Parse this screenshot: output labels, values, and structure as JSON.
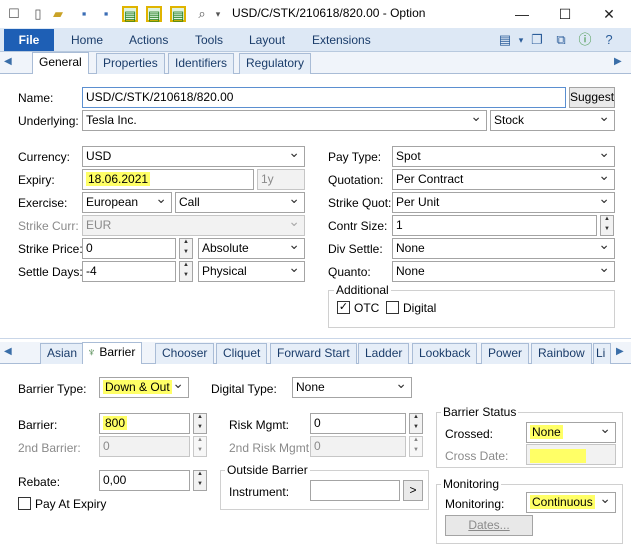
{
  "window": {
    "title": "USD/C/STK/210618/820.00 - Option",
    "minimize": "—",
    "maximize": "☐",
    "close": "✕"
  },
  "ribbon": {
    "file": "File",
    "tabs": [
      "Home",
      "Actions",
      "Tools",
      "Layout",
      "Extensions"
    ]
  },
  "top_tabs": [
    "General",
    "Properties",
    "Identifiers",
    "Regulatory"
  ],
  "general": {
    "name_label": "Name:",
    "name_value": "USD/C/STK/210618/820.00",
    "suggest": "Suggest",
    "underlying_label": "Underlying:",
    "underlying_value": "Tesla Inc.",
    "underlying_type": "Stock",
    "currency_label": "Currency:",
    "currency_value": "USD",
    "expiry_label": "Expiry:",
    "expiry_value": "18.06.2021",
    "expiry_tenor": "1y",
    "exercise_label": "Exercise:",
    "exercise_style": "European",
    "exercise_type": "Call",
    "strike_curr_label": "Strike Curr:",
    "strike_curr_value": "EUR",
    "strike_price_label": "Strike Price:",
    "strike_price_value": "0",
    "strike_price_mode": "Absolute",
    "settle_days_label": "Settle Days:",
    "settle_days_value": "-4",
    "settle_type": "Physical",
    "pay_type_label": "Pay Type:",
    "pay_type_value": "Spot",
    "quotation_label": "Quotation:",
    "quotation_value": "Per Contract",
    "strike_quot_label": "Strike Quot:",
    "strike_quot_value": "Per Unit",
    "contr_size_label": "Contr Size:",
    "contr_size_value": "1",
    "div_settle_label": "Div Settle:",
    "div_settle_value": "None",
    "quanto_label": "Quanto:",
    "quanto_value": "None",
    "additional_title": "Additional",
    "otc_label": "OTC",
    "otc_checked": "✓",
    "digital_label": "Digital"
  },
  "bottom_tabs": [
    "Asian",
    "Barrier",
    "Chooser",
    "Cliquet",
    "Forward Start",
    "Ladder",
    "Lookback",
    "Power",
    "Rainbow",
    "Li"
  ],
  "barrier": {
    "barrier_type_label": "Barrier Type:",
    "barrier_type_value": "Down & Out",
    "digital_type_label": "Digital Type:",
    "digital_type_value": "None",
    "barrier_label": "Barrier:",
    "barrier_value": "800",
    "second_barrier_label": "2nd Barrier:",
    "second_barrier_value": "0",
    "risk_mgmt_label": "Risk Mgmt:",
    "risk_mgmt_value": "0",
    "second_risk_mgmt_label": "2nd Risk Mgmt:",
    "second_risk_mgmt_value": "0",
    "rebate_label": "Rebate:",
    "rebate_value": "0,00",
    "pay_at_expiry_label": "Pay At Expiry",
    "outside_barrier_title": "Outside Barrier",
    "instrument_label": "Instrument:",
    "instrument_value": "",
    "browse": ">",
    "status_title": "Barrier Status",
    "crossed_label": "Crossed:",
    "crossed_value": "None",
    "cross_date_label": "Cross Date:",
    "monitoring_title": "Monitoring",
    "monitoring_label": "Monitoring:",
    "monitoring_value": "Continuous",
    "dates": "Dates..."
  },
  "colors": {
    "highlight": "#ffff66",
    "file_button": "#1e5fb5",
    "ribbon": "#dde8f5"
  }
}
